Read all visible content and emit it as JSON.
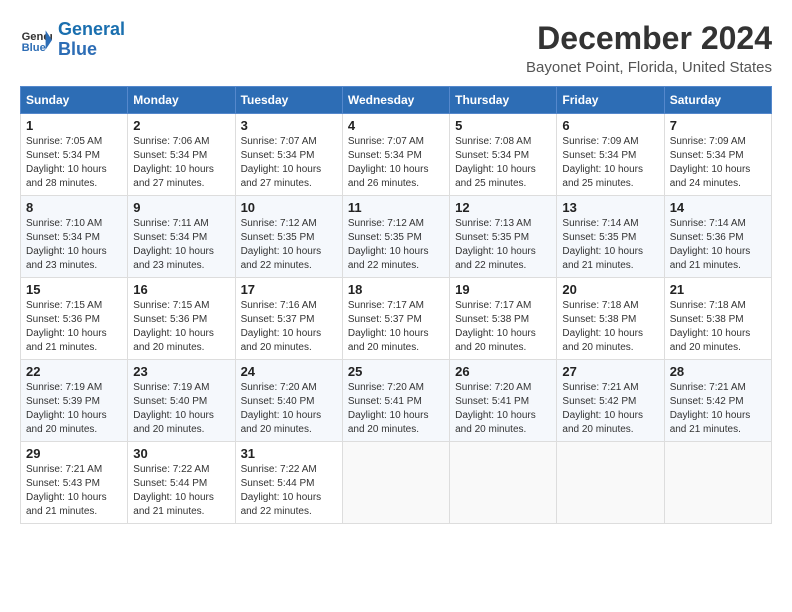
{
  "header": {
    "logo_line1": "General",
    "logo_line2": "Blue",
    "month": "December 2024",
    "location": "Bayonet Point, Florida, United States"
  },
  "weekdays": [
    "Sunday",
    "Monday",
    "Tuesday",
    "Wednesday",
    "Thursday",
    "Friday",
    "Saturday"
  ],
  "weeks": [
    [
      {
        "day": "1",
        "sunrise": "Sunrise: 7:05 AM",
        "sunset": "Sunset: 5:34 PM",
        "daylight": "Daylight: 10 hours and 28 minutes."
      },
      {
        "day": "2",
        "sunrise": "Sunrise: 7:06 AM",
        "sunset": "Sunset: 5:34 PM",
        "daylight": "Daylight: 10 hours and 27 minutes."
      },
      {
        "day": "3",
        "sunrise": "Sunrise: 7:07 AM",
        "sunset": "Sunset: 5:34 PM",
        "daylight": "Daylight: 10 hours and 27 minutes."
      },
      {
        "day": "4",
        "sunrise": "Sunrise: 7:07 AM",
        "sunset": "Sunset: 5:34 PM",
        "daylight": "Daylight: 10 hours and 26 minutes."
      },
      {
        "day": "5",
        "sunrise": "Sunrise: 7:08 AM",
        "sunset": "Sunset: 5:34 PM",
        "daylight": "Daylight: 10 hours and 25 minutes."
      },
      {
        "day": "6",
        "sunrise": "Sunrise: 7:09 AM",
        "sunset": "Sunset: 5:34 PM",
        "daylight": "Daylight: 10 hours and 25 minutes."
      },
      {
        "day": "7",
        "sunrise": "Sunrise: 7:09 AM",
        "sunset": "Sunset: 5:34 PM",
        "daylight": "Daylight: 10 hours and 24 minutes."
      }
    ],
    [
      {
        "day": "8",
        "sunrise": "Sunrise: 7:10 AM",
        "sunset": "Sunset: 5:34 PM",
        "daylight": "Daylight: 10 hours and 23 minutes."
      },
      {
        "day": "9",
        "sunrise": "Sunrise: 7:11 AM",
        "sunset": "Sunset: 5:34 PM",
        "daylight": "Daylight: 10 hours and 23 minutes."
      },
      {
        "day": "10",
        "sunrise": "Sunrise: 7:12 AM",
        "sunset": "Sunset: 5:35 PM",
        "daylight": "Daylight: 10 hours and 22 minutes."
      },
      {
        "day": "11",
        "sunrise": "Sunrise: 7:12 AM",
        "sunset": "Sunset: 5:35 PM",
        "daylight": "Daylight: 10 hours and 22 minutes."
      },
      {
        "day": "12",
        "sunrise": "Sunrise: 7:13 AM",
        "sunset": "Sunset: 5:35 PM",
        "daylight": "Daylight: 10 hours and 22 minutes."
      },
      {
        "day": "13",
        "sunrise": "Sunrise: 7:14 AM",
        "sunset": "Sunset: 5:35 PM",
        "daylight": "Daylight: 10 hours and 21 minutes."
      },
      {
        "day": "14",
        "sunrise": "Sunrise: 7:14 AM",
        "sunset": "Sunset: 5:36 PM",
        "daylight": "Daylight: 10 hours and 21 minutes."
      }
    ],
    [
      {
        "day": "15",
        "sunrise": "Sunrise: 7:15 AM",
        "sunset": "Sunset: 5:36 PM",
        "daylight": "Daylight: 10 hours and 21 minutes."
      },
      {
        "day": "16",
        "sunrise": "Sunrise: 7:15 AM",
        "sunset": "Sunset: 5:36 PM",
        "daylight": "Daylight: 10 hours and 20 minutes."
      },
      {
        "day": "17",
        "sunrise": "Sunrise: 7:16 AM",
        "sunset": "Sunset: 5:37 PM",
        "daylight": "Daylight: 10 hours and 20 minutes."
      },
      {
        "day": "18",
        "sunrise": "Sunrise: 7:17 AM",
        "sunset": "Sunset: 5:37 PM",
        "daylight": "Daylight: 10 hours and 20 minutes."
      },
      {
        "day": "19",
        "sunrise": "Sunrise: 7:17 AM",
        "sunset": "Sunset: 5:38 PM",
        "daylight": "Daylight: 10 hours and 20 minutes."
      },
      {
        "day": "20",
        "sunrise": "Sunrise: 7:18 AM",
        "sunset": "Sunset: 5:38 PM",
        "daylight": "Daylight: 10 hours and 20 minutes."
      },
      {
        "day": "21",
        "sunrise": "Sunrise: 7:18 AM",
        "sunset": "Sunset: 5:38 PM",
        "daylight": "Daylight: 10 hours and 20 minutes."
      }
    ],
    [
      {
        "day": "22",
        "sunrise": "Sunrise: 7:19 AM",
        "sunset": "Sunset: 5:39 PM",
        "daylight": "Daylight: 10 hours and 20 minutes."
      },
      {
        "day": "23",
        "sunrise": "Sunrise: 7:19 AM",
        "sunset": "Sunset: 5:40 PM",
        "daylight": "Daylight: 10 hours and 20 minutes."
      },
      {
        "day": "24",
        "sunrise": "Sunrise: 7:20 AM",
        "sunset": "Sunset: 5:40 PM",
        "daylight": "Daylight: 10 hours and 20 minutes."
      },
      {
        "day": "25",
        "sunrise": "Sunrise: 7:20 AM",
        "sunset": "Sunset: 5:41 PM",
        "daylight": "Daylight: 10 hours and 20 minutes."
      },
      {
        "day": "26",
        "sunrise": "Sunrise: 7:20 AM",
        "sunset": "Sunset: 5:41 PM",
        "daylight": "Daylight: 10 hours and 20 minutes."
      },
      {
        "day": "27",
        "sunrise": "Sunrise: 7:21 AM",
        "sunset": "Sunset: 5:42 PM",
        "daylight": "Daylight: 10 hours and 20 minutes."
      },
      {
        "day": "28",
        "sunrise": "Sunrise: 7:21 AM",
        "sunset": "Sunset: 5:42 PM",
        "daylight": "Daylight: 10 hours and 21 minutes."
      }
    ],
    [
      {
        "day": "29",
        "sunrise": "Sunrise: 7:21 AM",
        "sunset": "Sunset: 5:43 PM",
        "daylight": "Daylight: 10 hours and 21 minutes."
      },
      {
        "day": "30",
        "sunrise": "Sunrise: 7:22 AM",
        "sunset": "Sunset: 5:44 PM",
        "daylight": "Daylight: 10 hours and 21 minutes."
      },
      {
        "day": "31",
        "sunrise": "Sunrise: 7:22 AM",
        "sunset": "Sunset: 5:44 PM",
        "daylight": "Daylight: 10 hours and 22 minutes."
      },
      null,
      null,
      null,
      null
    ]
  ]
}
